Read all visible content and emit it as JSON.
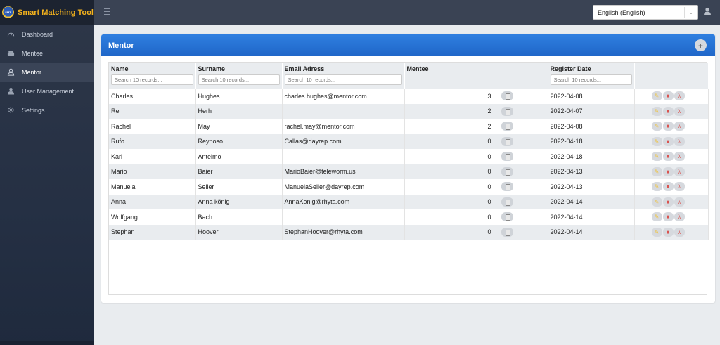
{
  "app": {
    "title": "Smart Matching Tool",
    "logo_text": "SMT"
  },
  "sidebar": {
    "items": [
      {
        "label": "Dashboard",
        "icon": "gauge-icon",
        "active": false
      },
      {
        "label": "Mentee",
        "icon": "group-icon",
        "active": false
      },
      {
        "label": "Mentor",
        "icon": "person-icon",
        "active": true
      },
      {
        "label": "User Management",
        "icon": "users-icon",
        "active": false
      },
      {
        "label": "Settings",
        "icon": "gear-icon",
        "active": false
      }
    ]
  },
  "topbar": {
    "language": "English (English)"
  },
  "card": {
    "title": "Mentor",
    "add_label": "+"
  },
  "table": {
    "columns": [
      "Name",
      "Surname",
      "Email Adress",
      "Mentee",
      "Register Date"
    ],
    "search_placeholder": "Search 10 records...",
    "rows": [
      [
        "Charles",
        "Hughes",
        "charles.hughes@mentor.com",
        "3",
        "2022-04-08"
      ],
      [
        "Re",
        "Herh",
        "",
        "2",
        "2022-04-07"
      ],
      [
        "Rachel",
        "May",
        "rachel.may@mentor.com",
        "2",
        "2022-04-08"
      ],
      [
        "Rufo",
        "Reynoso",
        "Callas@dayrep.com",
        "0",
        "2022-04-18"
      ],
      [
        "Kari",
        "Antelmo",
        "",
        "0",
        "2022-04-18"
      ],
      [
        "Mario",
        "Baier",
        "MarioBaier@teleworm.us",
        "0",
        "2022-04-13"
      ],
      [
        "Manuela",
        "Seiler",
        "ManuelaSeiler@dayrep.com",
        "0",
        "2022-04-13"
      ],
      [
        "Anna",
        "Anna könig",
        "AnnaKonig@rhyta.com",
        "0",
        "2022-04-14"
      ],
      [
        "Wolfgang",
        "Bach",
        "",
        "0",
        "2022-04-14"
      ],
      [
        "Stephan",
        "Hoover",
        "StephanHoover@rhyta.com",
        "0",
        "2022-04-14"
      ]
    ]
  },
  "colors": {
    "brand": "#f3b21d",
    "header_blue": "#1f66c8",
    "sidebar": "#253044"
  }
}
